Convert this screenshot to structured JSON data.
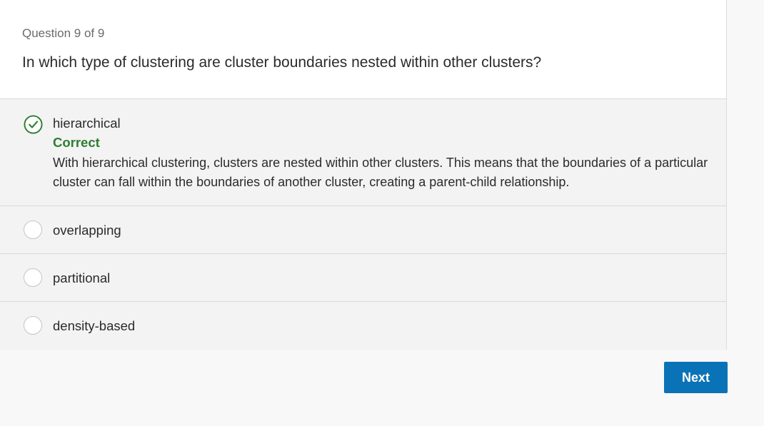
{
  "question": {
    "counter": "Question 9 of 9",
    "text": "In which type of clustering are cluster boundaries nested within other clusters?"
  },
  "options": [
    {
      "label": "hierarchical",
      "selected": true,
      "status": "Correct",
      "feedback": "With hierarchical clustering, clusters are nested within other clusters. This means that the boundaries of a particular cluster can fall within the boundaries of another cluster, creating a parent-child relationship."
    },
    {
      "label": "overlapping",
      "selected": false
    },
    {
      "label": "partitional",
      "selected": false
    },
    {
      "label": "density-based",
      "selected": false
    }
  ],
  "actions": {
    "next_label": "Next"
  },
  "colors": {
    "correct": "#2f7d32",
    "primary": "#0a73b7"
  },
  "icons": {
    "selected": "check-circle-icon",
    "unselected": "radio-empty-icon"
  }
}
